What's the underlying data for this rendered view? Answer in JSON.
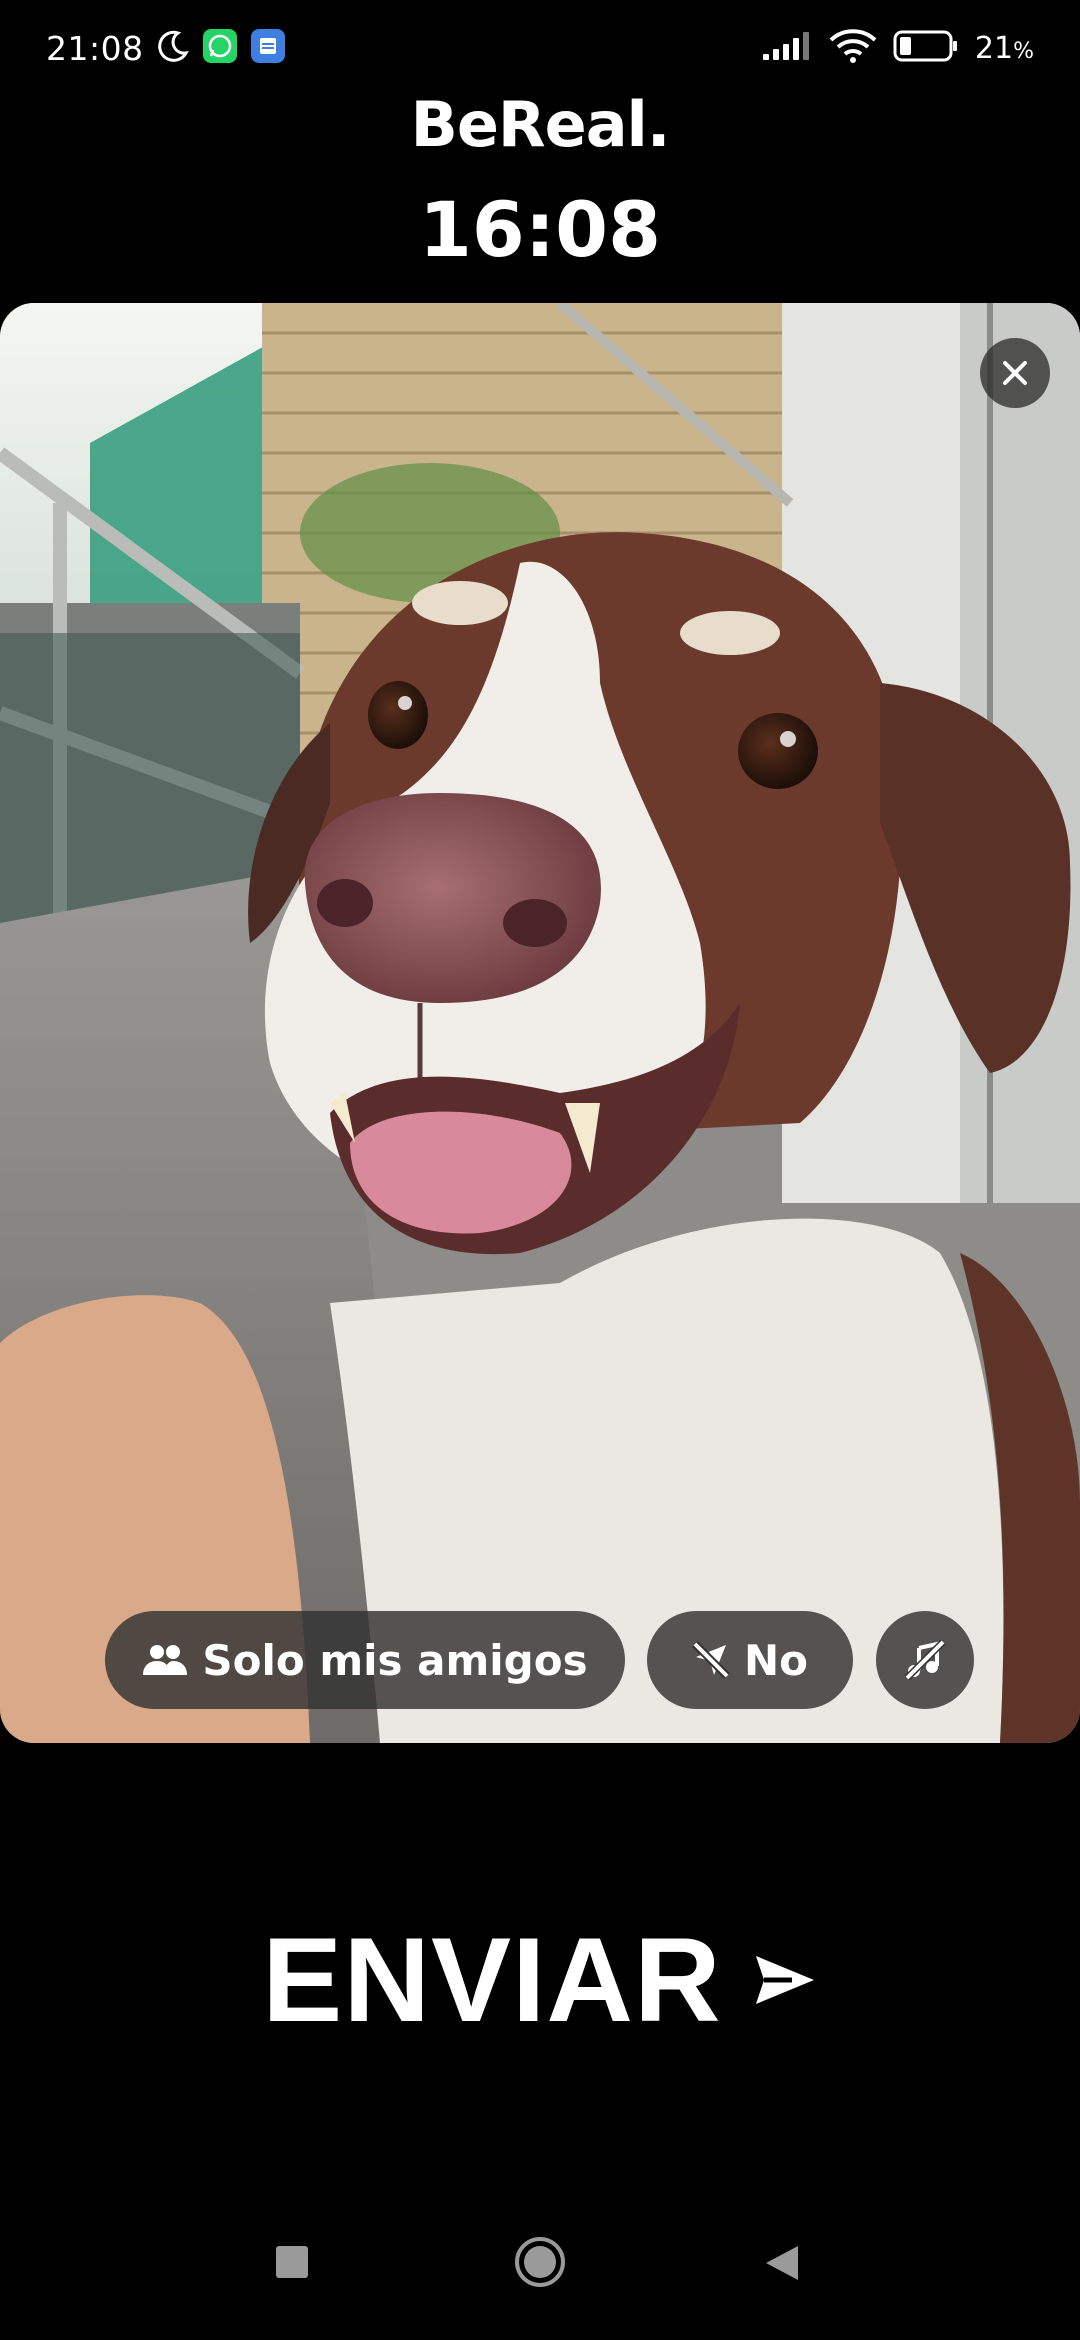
{
  "status_bar": {
    "time": "21:08",
    "battery_percent": "21",
    "battery_unit": "%",
    "icons": [
      "moon-icon",
      "whatsapp-icon",
      "notes-app-icon",
      "signal-icon",
      "wifi-icon",
      "battery-icon"
    ]
  },
  "header": {
    "app_title": "BeReal.",
    "clock": "16:08"
  },
  "photo": {
    "close_icon": "close-icon"
  },
  "options": {
    "audience_icon": "people-icon",
    "audience_label": "Solo mis amigos",
    "location_icon": "location-off-icon",
    "location_label": "No",
    "music_icon": "music-off-icon"
  },
  "send": {
    "label": "ENVIAR",
    "icon": "send-arrow-icon"
  },
  "nav": {
    "icons": [
      "recents-icon",
      "home-icon",
      "back-icon"
    ]
  },
  "colors": {
    "background": "#000000",
    "text": "#ffffff",
    "pill_bg": "#323232",
    "whatsapp": "#25D366",
    "notes_app": "#3F7FE0"
  }
}
